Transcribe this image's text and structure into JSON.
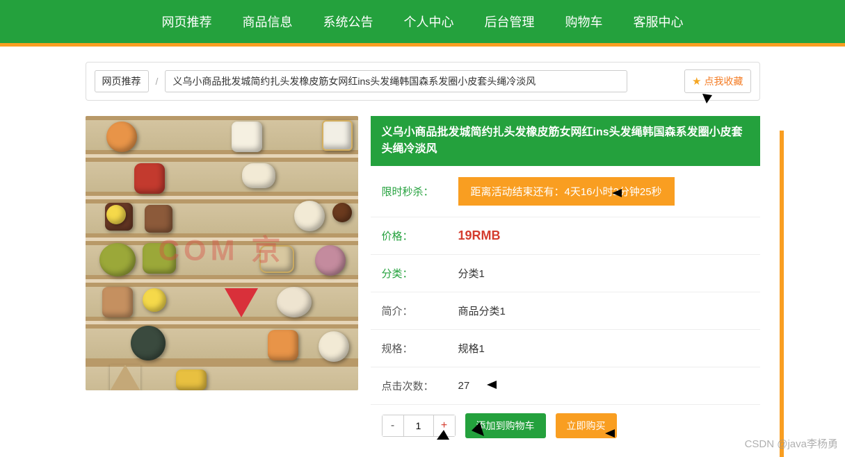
{
  "nav": {
    "items": [
      "网页推荐",
      "商品信息",
      "系统公告",
      "个人中心",
      "后台管理",
      "购物车",
      "客服中心"
    ]
  },
  "breadcrumb": {
    "home": "网页推荐",
    "title": "义乌小商品批发城简约扎头发橡皮筋女网红ins头发绳韩国森系发圈小皮套头绳冷淡风"
  },
  "favorite": {
    "label": "点我收藏"
  },
  "product": {
    "title": "义乌小商品批发城简约扎头发橡皮筋女网红ins头发绳韩国森系发圈小皮套头绳冷淡风",
    "labels": {
      "flash": "限时秒杀：",
      "price": "价格：",
      "category": "分类：",
      "intro": "简介：",
      "spec": "规格：",
      "clicks": "点击次数："
    },
    "countdown": "距离活动结束还有：4天16小时2分钟25秒",
    "price": "19RMB",
    "category": "分类1",
    "intro": "商品分类1",
    "spec": "规格1",
    "clicks": "27",
    "qty": "1",
    "add_cart": "添加到购物车",
    "buy_now": "立即购买"
  },
  "watermark": "CSDN @java李杨勇",
  "img_watermark": "COM 京"
}
